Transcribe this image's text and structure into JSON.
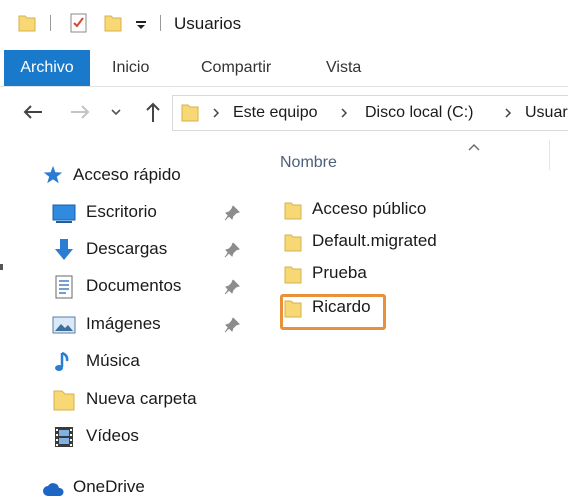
{
  "window": {
    "title": "Usuarios",
    "quick_access_toolbar": [
      "folder-icon",
      "properties-icon",
      "new-folder-icon",
      "customize-dropdown-icon"
    ]
  },
  "ribbon": {
    "tabs": [
      {
        "label": "Archivo",
        "active": true
      },
      {
        "label": "Inicio"
      },
      {
        "label": "Compartir"
      },
      {
        "label": "Vista"
      }
    ],
    "accent": "#1979ca"
  },
  "address_bar": {
    "crumbs": [
      "Este equipo",
      "Disco local (C:)",
      "Usuar"
    ]
  },
  "nav_pane": {
    "quick_access": "Acceso rápido",
    "items": [
      {
        "label": "Escritorio",
        "icon": "desktop-icon",
        "pinned": true
      },
      {
        "label": "Descargas",
        "icon": "downloads-icon",
        "pinned": true
      },
      {
        "label": "Documentos",
        "icon": "documents-icon",
        "pinned": true
      },
      {
        "label": "Imágenes",
        "icon": "pictures-icon",
        "pinned": true
      },
      {
        "label": "Música",
        "icon": "music-icon",
        "pinned": false
      },
      {
        "label": "Nueva carpeta",
        "icon": "folder-icon",
        "pinned": false
      },
      {
        "label": "Vídeos",
        "icon": "videos-icon",
        "pinned": false
      }
    ],
    "onedrive": "OneDrive"
  },
  "content": {
    "column_header": "Nombre",
    "folders": [
      "Acceso público",
      "Default.migrated",
      "Prueba",
      "Ricardo"
    ],
    "highlighted": "Ricardo",
    "highlight_color": "#e8913a"
  }
}
